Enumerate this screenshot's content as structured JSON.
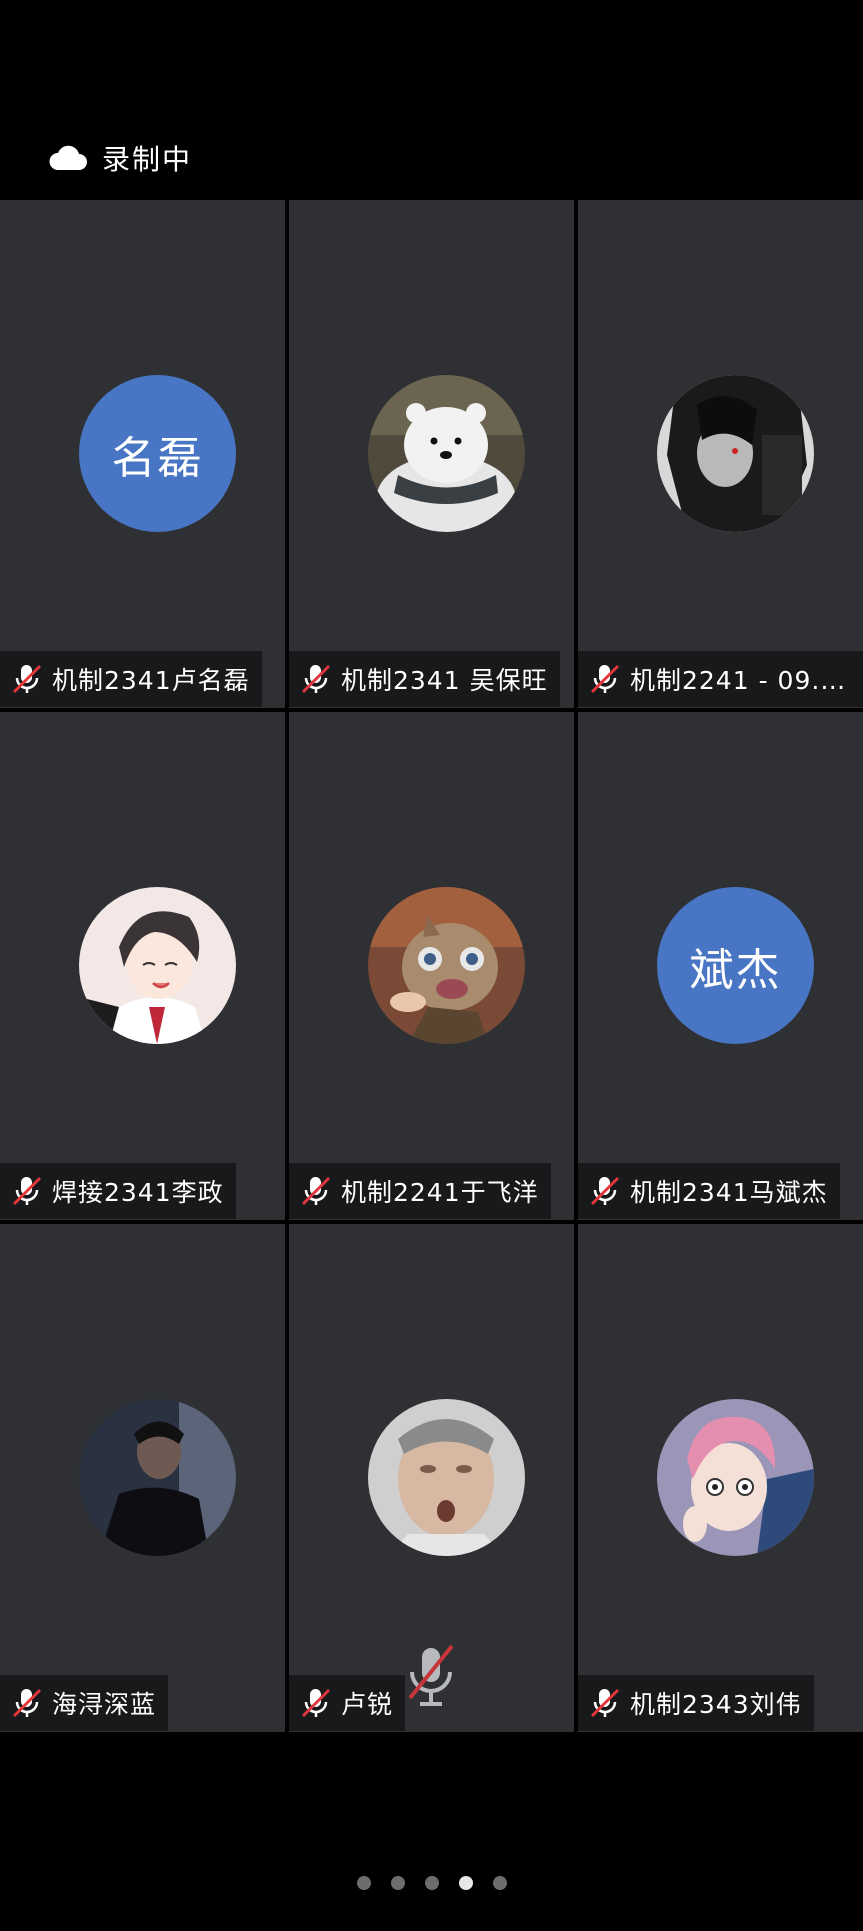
{
  "recording": {
    "label": "录制中",
    "icon": "cloud-icon"
  },
  "participants": [
    {
      "name": "机制2341卢名磊",
      "avatar_text": "名磊",
      "avatar_type": "text",
      "mic": "mic-muted-icon"
    },
    {
      "name": "机制2341 吴保旺",
      "avatar_type": "image",
      "avatar_desc": "polar-bear-plush",
      "mic": "mic-muted-icon"
    },
    {
      "name": "机制2241 - 09.…",
      "avatar_type": "image",
      "avatar_desc": "anime-dark-hair",
      "mic": "mic-muted-icon"
    },
    {
      "name": "焊接2341李政",
      "avatar_type": "image",
      "avatar_desc": "anime-smiling-boy",
      "mic": "mic-muted-icon"
    },
    {
      "name": "机制2241于飞洋",
      "avatar_type": "image",
      "avatar_desc": "anime-boar-mask",
      "mic": "mic-muted-icon"
    },
    {
      "name": "机制2341马斌杰",
      "avatar_text": "斌杰",
      "avatar_type": "text",
      "mic": "mic-muted-icon"
    },
    {
      "name": "海浔深蓝",
      "avatar_type": "image",
      "avatar_desc": "man-dark-portrait",
      "mic": "mic-muted-icon"
    },
    {
      "name": "卢锐",
      "avatar_type": "image",
      "avatar_desc": "man-face-photo",
      "mic": "mic-muted-icon"
    },
    {
      "name": "机制2343刘伟",
      "avatar_type": "image",
      "avatar_desc": "anime-pink-hair",
      "mic": "mic-muted-icon"
    }
  ],
  "pagination": {
    "pages": 5,
    "current": 4
  },
  "colors": {
    "tile_bg": "#2e3033",
    "avatar_blue": "#4876c4",
    "mute_red": "#e0363c"
  }
}
